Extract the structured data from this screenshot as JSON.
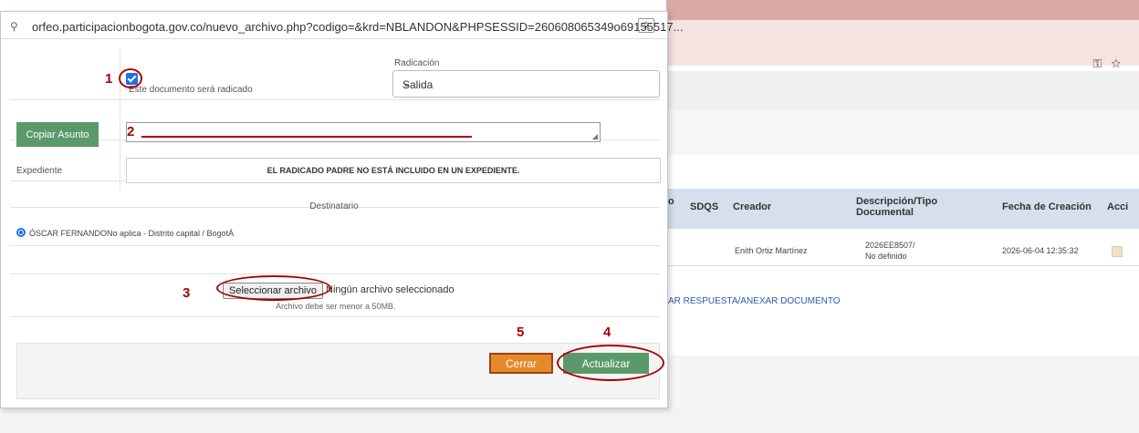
{
  "background": {
    "table_headers": [
      "SDQS",
      "Creador",
      "Descripción/Tipo Documental",
      "Fecha de Creación",
      "Acci"
    ],
    "header_lead": "o",
    "row": {
      "creador": "Enith Ortiz Martínez",
      "descripcion_line1": "2026EE8507/",
      "descripcion_line2": "No definido",
      "fecha": "2026-06-04 12:35:32"
    },
    "link_text": "AR RESPUESTA/ANEXAR DOCUMENTO",
    "addr_icons": "⚿☆"
  },
  "popup": {
    "url": "orfeo.participacionbogota.gov.co/nuevo_archivo.php?codigo=&krd=NBLANDON&PHPSESSID=260608065349o69155517...",
    "radicado_checkbox_label": "Este documento será radicado",
    "radicado_checked": true,
    "radicacion_label": "Radicación",
    "radicacion_value": "Salida",
    "copiar_asunto": "Copiar Asunto",
    "asunto_value": "",
    "expediente_label": "Expediente",
    "expediente_value": "EL RADICADO PADRE NO ESTÁ INCLUIDO EN UN EXPEDIENTE.",
    "destinatario_label": "Destinatario",
    "destinatario_option": "ÓSCAR FERNANDONo aplica - Distrito capital / BogotÁ",
    "file_button": "Seleccionar archivo",
    "file_status": "Ningún archivo seleccionado",
    "file_note": "Archivo debe ser menor a 50MB.",
    "cerrar": "Cerrar",
    "actualizar": "Actualizar"
  },
  "annotations": {
    "n1": "1",
    "n2": "2",
    "n3": "3",
    "n4": "4",
    "n5": "5"
  },
  "colors": {
    "green_button": "#5a9a6a",
    "orange_button": "#e48a2c",
    "annotation_red": "#a00000",
    "checkbox_blue": "#1a73e8"
  }
}
